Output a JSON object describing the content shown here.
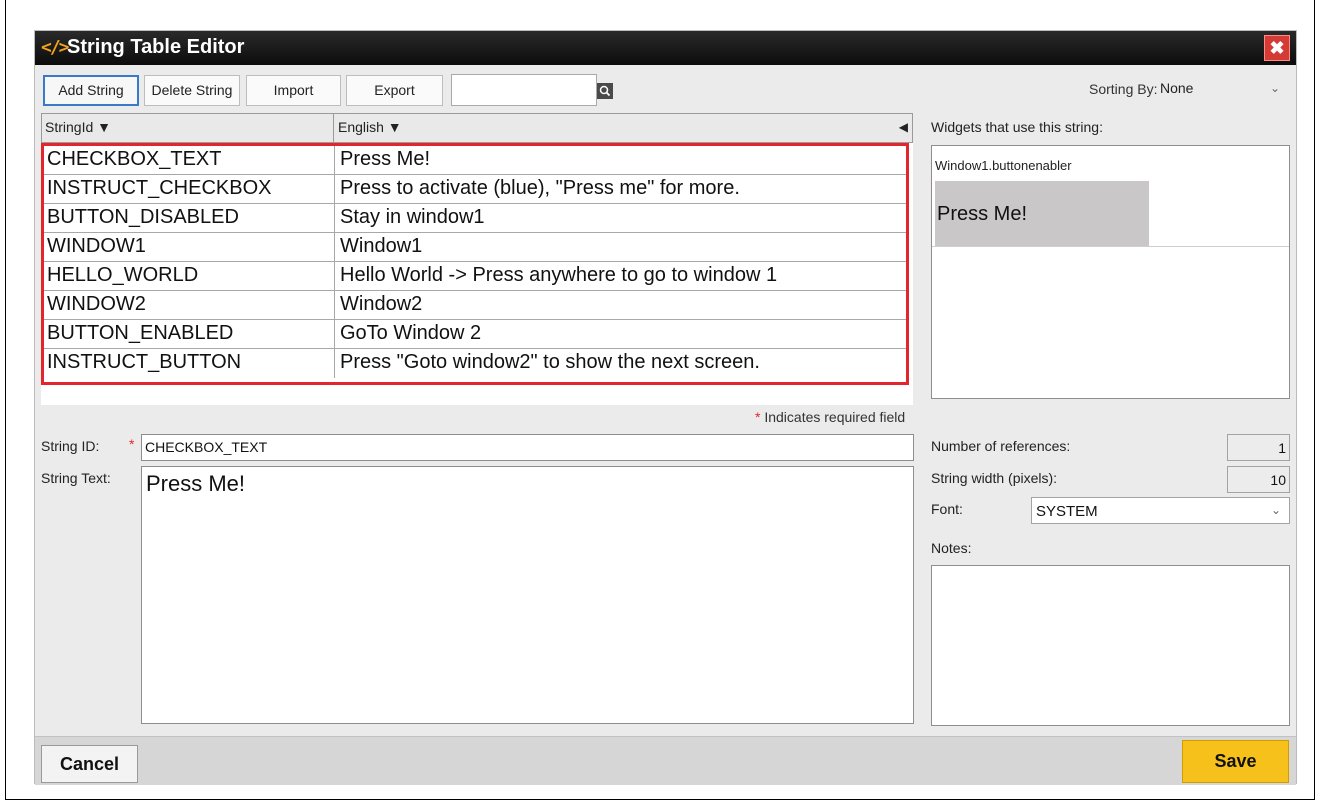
{
  "dialog": {
    "title": "String Table Editor",
    "logo": "</>",
    "close_icon": "✖"
  },
  "toolbar": {
    "add_label": "Add String",
    "delete_label": "Delete String",
    "import_label": "Import",
    "export_label": "Export",
    "search_value": "",
    "search_icon": "magnifier-icon",
    "sort_label": "Sorting By:",
    "sort_value": "None"
  },
  "table": {
    "col_id": "StringId ▼",
    "col_text": "English ▼",
    "collapse_arrow": "◀",
    "rows": [
      {
        "id": "CHECKBOX_TEXT",
        "text": "Press Me!"
      },
      {
        "id": "INSTRUCT_CHECKBOX",
        "text": "Press to activate (blue), \"Press me\" for more."
      },
      {
        "id": "BUTTON_DISABLED",
        "text": "Stay in window1"
      },
      {
        "id": "WINDOW1",
        "text": "Window1"
      },
      {
        "id": "HELLO_WORLD",
        "text": "Hello World -> Press anywhere to go to window 1"
      },
      {
        "id": "WINDOW2",
        "text": "Window2"
      },
      {
        "id": "BUTTON_ENABLED",
        "text": "GoTo Window 2"
      },
      {
        "id": "INSTRUCT_BUTTON",
        "text": "Press \"Goto window2\" to show the next screen."
      }
    ],
    "highlight_color": "#e3262c"
  },
  "form": {
    "required_note": "Indicates required field",
    "required_star": "*",
    "string_id_label": "String ID:",
    "string_id_value": "CHECKBOX_TEXT",
    "string_text_label": "String Text:",
    "string_text_value": "Press Me!"
  },
  "side": {
    "widgets_label": "Widgets that use this string:",
    "widget_name": "Window1.buttonenabler",
    "widget_preview_text": "Press Me!",
    "references_label": "Number of references:",
    "references_value": "1",
    "width_label": "String width (pixels):",
    "width_value": "10",
    "font_label": "Font:",
    "font_value": "SYSTEM",
    "notes_label": "Notes:"
  },
  "footer": {
    "cancel_label": "Cancel",
    "save_label": "Save",
    "save_color": "#f7c11c"
  }
}
